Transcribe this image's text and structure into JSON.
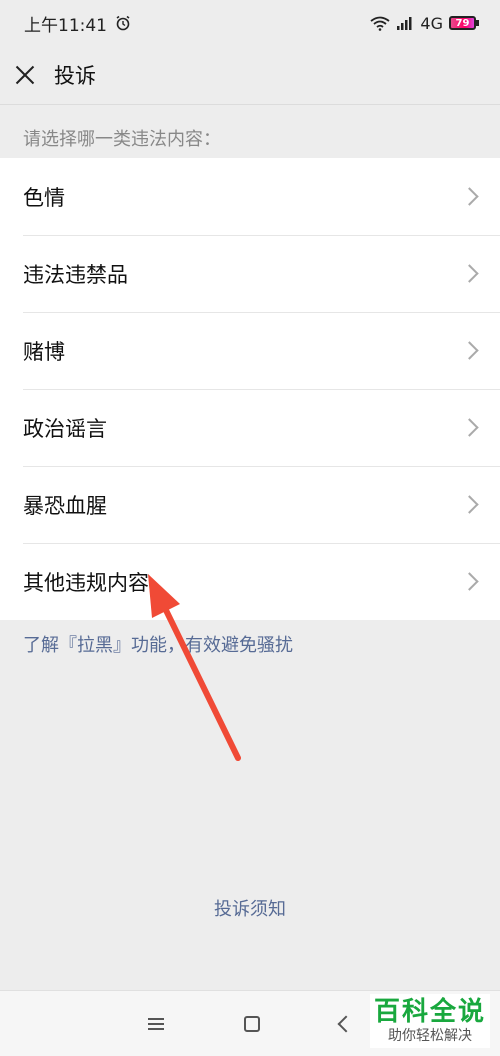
{
  "status_bar": {
    "time": "上午11:41",
    "network": "4G",
    "battery": "79"
  },
  "header": {
    "title": "投诉"
  },
  "section_label": "请选择哪一类违法内容：",
  "items": [
    {
      "label": "色情"
    },
    {
      "label": "违法违禁品"
    },
    {
      "label": "赌博"
    },
    {
      "label": "政治谣言"
    },
    {
      "label": "暴恐血腥"
    },
    {
      "label": "其他违规内容"
    }
  ],
  "blacklist_link": "了解『拉黑』功能，有效避免骚扰",
  "notice_link": "投诉须知",
  "watermark": {
    "main": "百科全说",
    "sub": "助你轻松解决"
  },
  "colors": {
    "link": "#576b95",
    "arrow": "#f04a36",
    "background": "#ededed"
  }
}
